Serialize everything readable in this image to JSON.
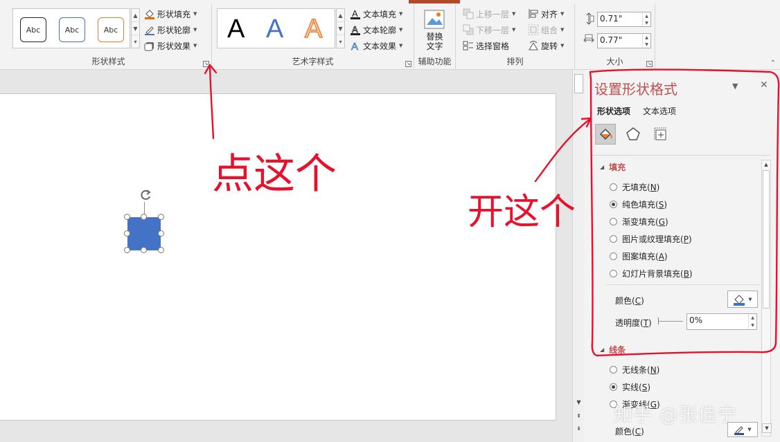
{
  "ribbon": {
    "shape_styles": {
      "label": "形状样式",
      "swatch_text": "Abc",
      "commands": {
        "fill": "形状填充",
        "outline": "形状轮廓",
        "effects": "形状效果"
      }
    },
    "wordart_styles": {
      "label": "艺术字样式",
      "letter": "A",
      "commands": {
        "text_fill": "文本填充",
        "text_outline": "文本轮廓",
        "text_effects": "文本效果"
      }
    },
    "accessibility": {
      "label": "辅助功能",
      "alt_text_line1": "替换",
      "alt_text_line2": "文字"
    },
    "arrange": {
      "label": "排列",
      "bring_forward": "上移一层",
      "send_backward": "下移一层",
      "selection_pane": "选择窗格",
      "align": "对齐",
      "group": "组合",
      "rotate": "旋转"
    },
    "size": {
      "label": "大小",
      "height": "0.71\"",
      "width": "0.77\""
    }
  },
  "pane": {
    "title": "设置形状格式",
    "tabs": {
      "shape_options": "形状选项",
      "text_options": "文本选项"
    },
    "fill_section": {
      "title": "填充",
      "options": [
        {
          "label": "无填充(",
          "key": "N",
          "checked": false
        },
        {
          "label": "纯色填充(",
          "key": "S",
          "checked": true
        },
        {
          "label": "渐变填充(",
          "key": "G",
          "checked": false
        },
        {
          "label": "图片或纹理填充(",
          "key": "P",
          "checked": false
        },
        {
          "label": "图案填充(",
          "key": "A",
          "checked": false
        },
        {
          "label": "幻灯片背景填充(",
          "key": "B",
          "checked": false
        }
      ],
      "color_label": "颜色(",
      "color_key": "C",
      "transparency_label": "透明度(",
      "transparency_key": "T",
      "transparency_value": "0%"
    },
    "line_section": {
      "title": "线条",
      "options": [
        {
          "label": "无线条(",
          "key": "N",
          "checked": false
        },
        {
          "label": "实线(",
          "key": "S",
          "checked": true
        },
        {
          "label": "渐变线(",
          "key": "G",
          "checked": false
        }
      ],
      "color_label": "颜色(",
      "color_key": "C"
    }
  },
  "annotations": {
    "left": "点这个",
    "right": "开这个"
  },
  "watermark": "知乎 @张佳宁",
  "colors": {
    "accent": "#c0504d",
    "shape_fill": "#4472c4",
    "ink": "#e8102a"
  }
}
